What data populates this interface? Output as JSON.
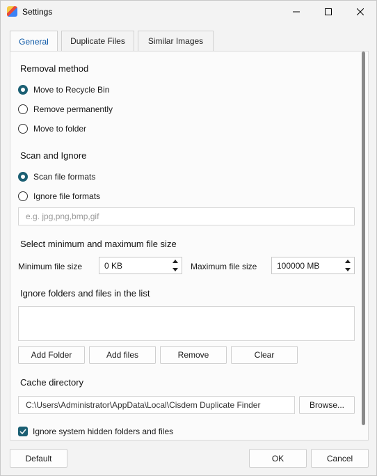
{
  "window": {
    "title": "Settings"
  },
  "tabs": [
    {
      "label": "General",
      "active": true
    },
    {
      "label": "Duplicate Files",
      "active": false
    },
    {
      "label": "Similar Images",
      "active": false
    }
  ],
  "removal": {
    "heading": "Removal method",
    "options": [
      {
        "label": "Move to Recycle Bin",
        "selected": true
      },
      {
        "label": "Remove permanently",
        "selected": false
      },
      {
        "label": "Move to folder",
        "selected": false
      }
    ]
  },
  "scan": {
    "heading": "Scan and Ignore",
    "options": [
      {
        "label": "Scan file formats",
        "selected": true
      },
      {
        "label": "Ignore file formats",
        "selected": false
      }
    ],
    "formats_placeholder": "e.g. jpg,png,bmp,gif"
  },
  "size": {
    "heading": "Select minimum and maximum file size",
    "min_label": "Minimum file size",
    "min_value": "0 KB",
    "max_label": "Maximum file size",
    "max_value": "100000 MB"
  },
  "ignore_list": {
    "heading": "Ignore folders and files in the list",
    "buttons": {
      "add_folder": "Add Folder",
      "add_files": "Add files",
      "remove": "Remove",
      "clear": "Clear"
    }
  },
  "cache": {
    "heading": "Cache directory",
    "path": "C:\\Users\\Administrator\\AppData\\Local\\Cisdem Duplicate Finder",
    "browse": "Browse..."
  },
  "hidden_checkbox": {
    "label": "Ignore system hidden folders and files",
    "checked": true
  },
  "footer": {
    "default": "Default",
    "ok": "OK",
    "cancel": "Cancel"
  },
  "colors": {
    "accent": "#1b5f73",
    "active_tab_text": "#0f5aa8"
  }
}
